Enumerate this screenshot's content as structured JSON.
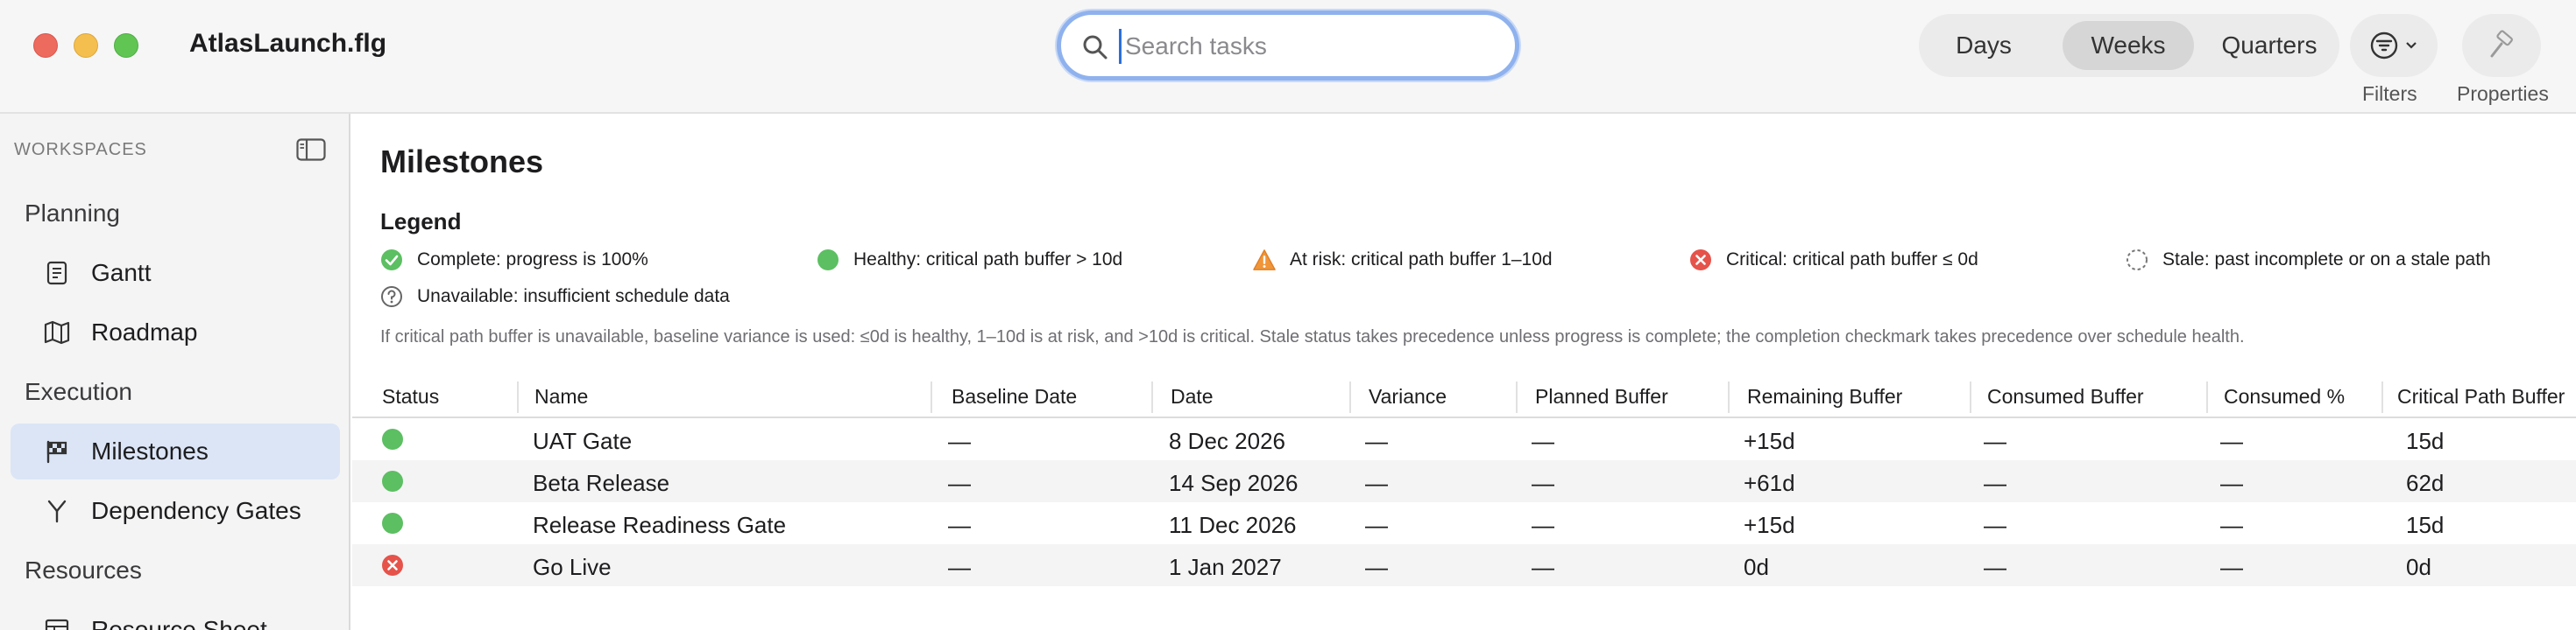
{
  "window": {
    "title": "AtlasLaunch.flg"
  },
  "search": {
    "placeholder": "Search tasks",
    "value": ""
  },
  "toolbar": {
    "segments": [
      "Days",
      "Weeks",
      "Quarters"
    ],
    "selected_segment": "Weeks",
    "filters_label": "Filters",
    "properties_label": "Properties"
  },
  "sidebar": {
    "header": "WORKSPACES",
    "sections": [
      {
        "label": "Planning",
        "items": [
          {
            "label": "Gantt",
            "icon": "document-icon"
          },
          {
            "label": "Roadmap",
            "icon": "map-icon"
          }
        ]
      },
      {
        "label": "Execution",
        "items": [
          {
            "label": "Milestones",
            "icon": "flag-icon",
            "active": true
          },
          {
            "label": "Dependency Gates",
            "icon": "branch-icon"
          }
        ]
      },
      {
        "label": "Resources",
        "items": [
          {
            "label": "Resource Sheet",
            "icon": "table-icon"
          }
        ]
      }
    ]
  },
  "main": {
    "title": "Milestones",
    "legend": {
      "title": "Legend",
      "items": [
        {
          "icon": "check-circle-icon",
          "text": "Complete: progress is 100%"
        },
        {
          "icon": "green-dot-icon",
          "text": "Healthy: critical path buffer > 10d"
        },
        {
          "icon": "warning-triangle-icon",
          "text": "At risk: critical path buffer 1–10d"
        },
        {
          "icon": "critical-x-icon",
          "text": "Critical: critical path buffer ≤ 0d"
        },
        {
          "icon": "dashed-circle-icon",
          "text": "Stale: past incomplete or on a stale path"
        },
        {
          "icon": "question-circle-icon",
          "text": "Unavailable: insufficient schedule data"
        }
      ],
      "note": "If critical path buffer is unavailable, baseline variance is used: ≤0d is healthy, 1–10d is at risk, and >10d is critical. Stale status takes precedence unless progress is complete; the completion checkmark takes precedence over schedule health."
    },
    "table": {
      "columns": [
        "Status",
        "Name",
        "Baseline Date",
        "Date",
        "Variance",
        "Planned Buffer",
        "Remaining Buffer",
        "Consumed Buffer",
        "Consumed %",
        "Critical Path Buffer"
      ],
      "rows": [
        {
          "status": "healthy",
          "name": "UAT Gate",
          "baseline": "—",
          "date": "8 Dec 2026",
          "variance": "—",
          "planned": "—",
          "remaining": "+15d",
          "consumed": "—",
          "consumed_pct": "—",
          "cp_buffer": "15d"
        },
        {
          "status": "healthy",
          "name": "Beta Release",
          "baseline": "—",
          "date": "14 Sep 2026",
          "variance": "—",
          "planned": "—",
          "remaining": "+61d",
          "consumed": "—",
          "consumed_pct": "—",
          "cp_buffer": "62d"
        },
        {
          "status": "healthy",
          "name": "Release Readiness Gate",
          "baseline": "—",
          "date": "11 Dec 2026",
          "variance": "—",
          "planned": "—",
          "remaining": "+15d",
          "consumed": "—",
          "consumed_pct": "—",
          "cp_buffer": "15d"
        },
        {
          "status": "critical",
          "name": "Go Live",
          "baseline": "—",
          "date": "1 Jan 2027",
          "variance": "—",
          "planned": "—",
          "remaining": "0d",
          "consumed": "—",
          "consumed_pct": "—",
          "cp_buffer": "0d"
        }
      ]
    }
  },
  "colors": {
    "healthy": "#5cbf62",
    "critical": "#e5534b",
    "warning": "#f0953a",
    "accent": "#2a6fdb",
    "selection": "#dbe5f6"
  }
}
